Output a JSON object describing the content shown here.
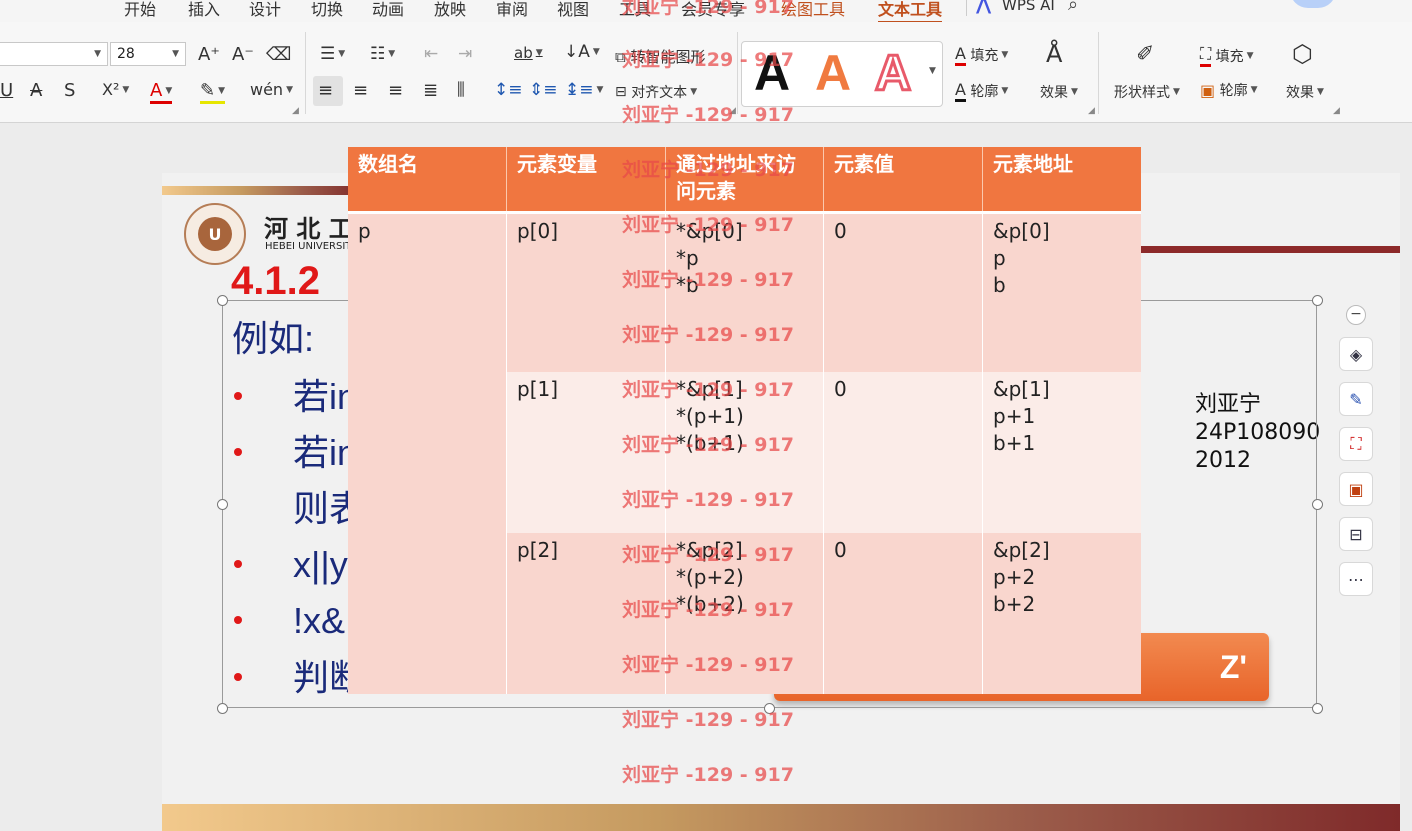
{
  "menu": {
    "items": [
      "开始",
      "插入",
      "设计",
      "切换",
      "动画",
      "放映",
      "审阅",
      "视图",
      "工具",
      "会员专享",
      "绘图工具",
      "文本工具"
    ],
    "wps_ai": "WPS AI"
  },
  "ribbon": {
    "font_size": "28",
    "smart_shape": "转智能图形",
    "align_text": "对齐文本",
    "fill": "填充",
    "outline": "轮廓",
    "effect": "效果",
    "shape_style": "形状样式",
    "fill2": "填充",
    "outline2": "轮廓",
    "effect2": "效果",
    "text_style_glyph": "A"
  },
  "slide": {
    "logo_text": "河 北 工",
    "logo_subtext": "HEBEI UNIVERSITY",
    "section_number": "4.1.2",
    "example_label": "例如:",
    "lines": [
      "若in",
      "若in",
      "则表",
      "x||y",
      "!x&",
      "判断"
    ],
    "name_block": "刘亚宁\n24P108090\n2012",
    "button_fragment": "Z'"
  },
  "table": {
    "headers": [
      "数组名",
      "元素变量",
      "通过地址来访问元素",
      "元素值",
      "元素地址"
    ],
    "array_name": "p",
    "rows": [
      {
        "var": "p[0]",
        "access": "*&p[0]\n*p\n*b",
        "value": "0",
        "addr": "&p[0]\np\nb"
      },
      {
        "var": "p[1]",
        "access": "*&p[1]\n*(p+1)\n*(b+1)",
        "value": "0",
        "addr": "&p[1]\np+1\nb+1"
      },
      {
        "var": "p[2]",
        "access": "*&p[2]\n*(p+2)\n*(b+2)",
        "value": "0",
        "addr": "&p[2]\np+2\nb+2"
      }
    ]
  },
  "watermark": "刘亚宁 -129 - 917",
  "colors": {
    "header_orange": "#f07640",
    "accent_red": "#e01818",
    "navy_text": "#1a2a7a",
    "watermark_red": "#e84848",
    "active_tab": "#c0501e"
  }
}
